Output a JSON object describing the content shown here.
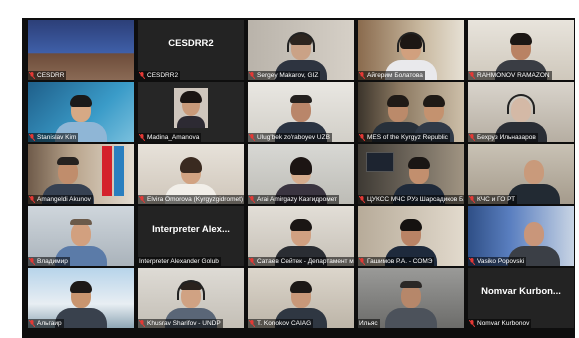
{
  "meeting": {
    "accent_color": "#b9f01f",
    "muted_icon": "mic-muted-icon",
    "participants": [
      {
        "name": "CESDRR",
        "muted": true
      },
      {
        "name": "CESDRR2",
        "display": "CESDRR2",
        "muted": true
      },
      {
        "name": "Sergey Makarov, GIZ",
        "muted": true
      },
      {
        "name": "Айгерим Болатова",
        "muted": true
      },
      {
        "name": "RAHMONOV RAMAZON",
        "muted": true
      },
      {
        "name": "Stanislav Kim",
        "muted": true
      },
      {
        "name": "Madina_Amanova",
        "muted": true
      },
      {
        "name": "Ulug'bek zo'raboyev UZB",
        "muted": true
      },
      {
        "name": "MES of the Kyrgyz Republic",
        "muted": true
      },
      {
        "name": "Бехруз Ильназаров",
        "muted": true
      },
      {
        "name": "Amangeldi Akunov",
        "muted": true
      },
      {
        "name": "Elvira Omorova (Kyrgyzgidromet)",
        "muted": true
      },
      {
        "name": "Arai Amirgazy Казгидромет",
        "muted": true
      },
      {
        "name": "ЦУКСС МЧС РУз Шарсадиков Б.А.",
        "muted": true
      },
      {
        "name": "КЧС и ГО РТ",
        "muted": true,
        "active": true
      },
      {
        "name": "Владимир",
        "muted": true
      },
      {
        "name": "Interpreter Alexander Golub",
        "display": "Interpreter Alex...",
        "muted": true
      },
      {
        "name": "Сатаев Сейтек - Департамент мо...",
        "muted": true
      },
      {
        "name": "Гашимов Р.А. - СОМЭ",
        "muted": true
      },
      {
        "name": "Vasiko Popovski",
        "muted": true
      },
      {
        "name": "Альгаир",
        "muted": true
      },
      {
        "name": "Khusrav Sharifov - UNDP",
        "muted": true
      },
      {
        "name": "T. Konokov CAIAG",
        "muted": true
      },
      {
        "name": "Ильяс",
        "muted": true
      },
      {
        "name": "Nomvar Kurbonov",
        "display": "Nomvar Kurbon...",
        "muted": true
      }
    ]
  }
}
